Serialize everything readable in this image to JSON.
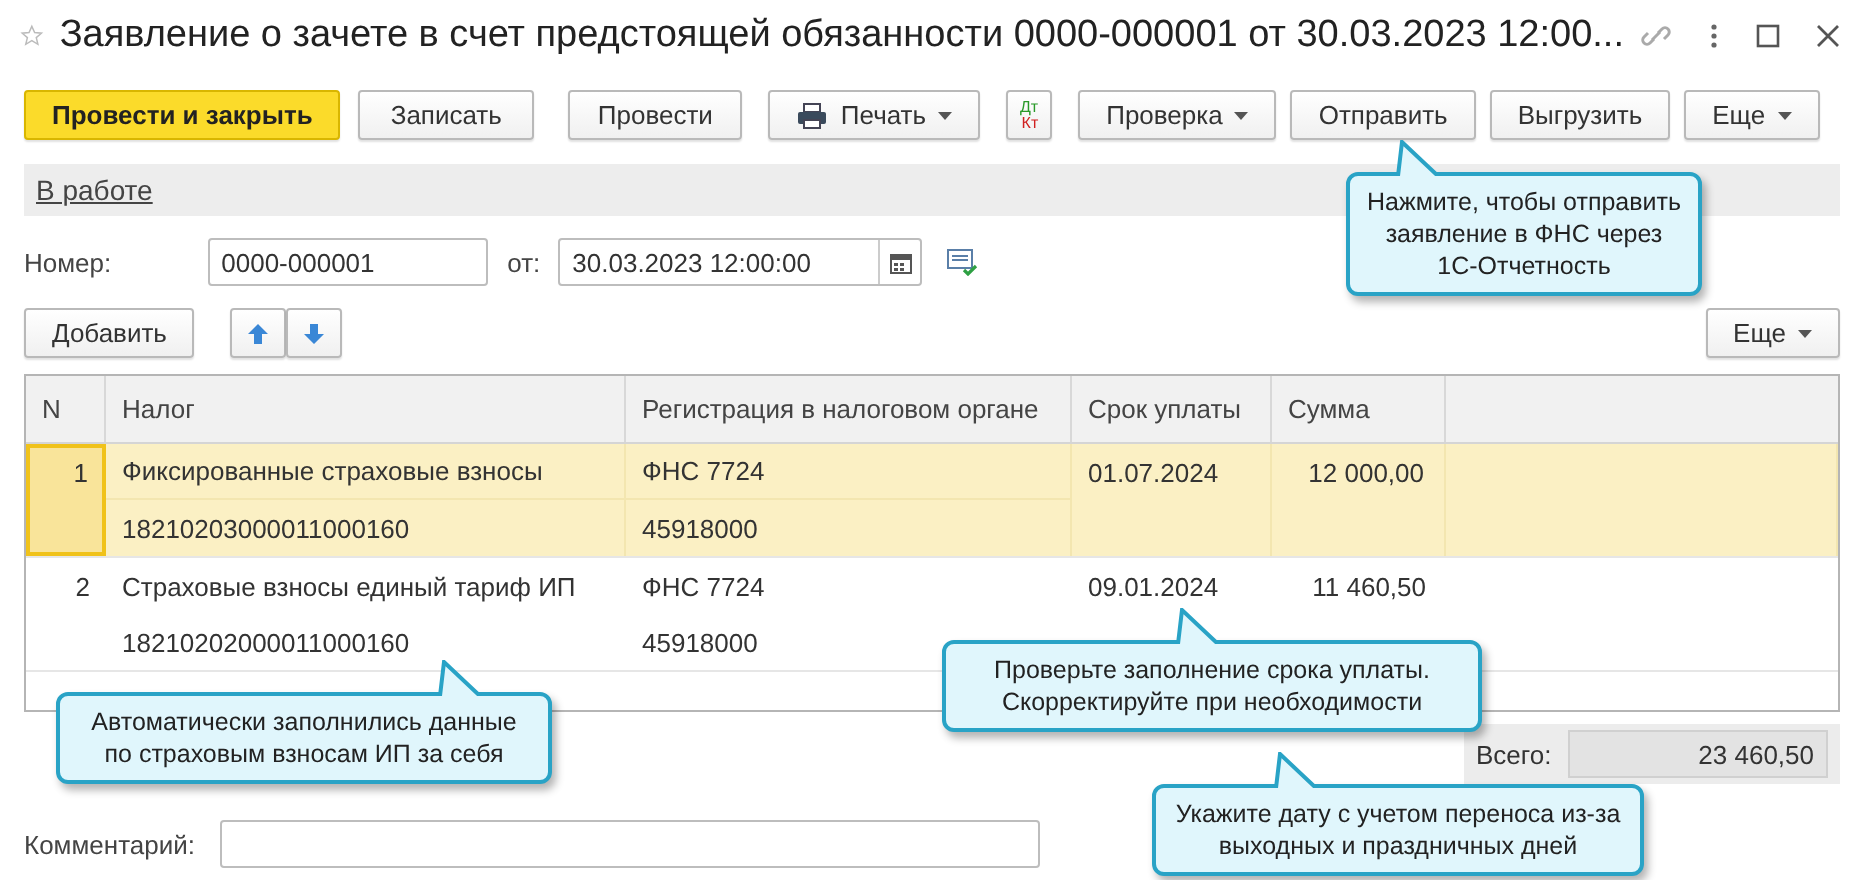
{
  "window": {
    "title": "Заявление о зачете в счет предстоящей обязанности 0000-000001 от 30.03.2023 12:00..."
  },
  "toolbar": [
    {
      "kind": "primary",
      "label": "Провести и закрыть"
    },
    {
      "kind": "plain",
      "label": "Записать"
    },
    {
      "kind": "plain",
      "label": "Провести"
    },
    {
      "kind": "print",
      "label": "Печать"
    },
    {
      "kind": "dtkt",
      "label": "Дт",
      "label2": "Кт"
    },
    {
      "kind": "menu",
      "label": "Проверка"
    },
    {
      "kind": "plain",
      "label": "Отправить"
    },
    {
      "kind": "plain",
      "label": "Выгрузить"
    },
    {
      "kind": "menu",
      "label": "Еще"
    }
  ],
  "status": {
    "label": "В работе"
  },
  "number": {
    "label": "Номер:",
    "value": "0000-000001"
  },
  "date": {
    "label": "от:",
    "value": "30.03.2023 12:00:00"
  },
  "table_toolbar": {
    "add": "Добавить",
    "more": "Еще"
  },
  "table": {
    "columns": [
      "N",
      "Налог",
      "Регистрация в налоговом органе",
      "Срок уплаты",
      "Сумма"
    ],
    "rows": [
      {
        "n": "1",
        "tax": "Фиксированные страховые взносы",
        "kbk": "18210203000011000160",
        "authority": "ФНС 7724",
        "oktmo": "45918000",
        "due": "01.07.2024",
        "sum": "12 000,00",
        "selected": true
      },
      {
        "n": "2",
        "tax": "Страховые взносы единый тариф ИП",
        "kbk": "18210202000011000160",
        "authority": "ФНС 7724",
        "oktmo": "45918000",
        "due": "09.01.2024",
        "sum": "11 460,50",
        "selected": false
      }
    ]
  },
  "total": {
    "label": "Всего:",
    "value": "23 460,50"
  },
  "comment": {
    "label": "Комментарий:"
  },
  "callouts": [
    {
      "text": "Нажмите, чтобы отправить заявление в ФНС через 1С-Отчетность"
    },
    {
      "text": "Автоматически заполнились данные по страховым взносам ИП за себя"
    },
    {
      "text": "Проверьте заполнение срока уплаты. Скорректируйте при необходимости"
    },
    {
      "text": "Укажите дату с учетом переноса из-за выходных и праздничных дней"
    }
  ]
}
